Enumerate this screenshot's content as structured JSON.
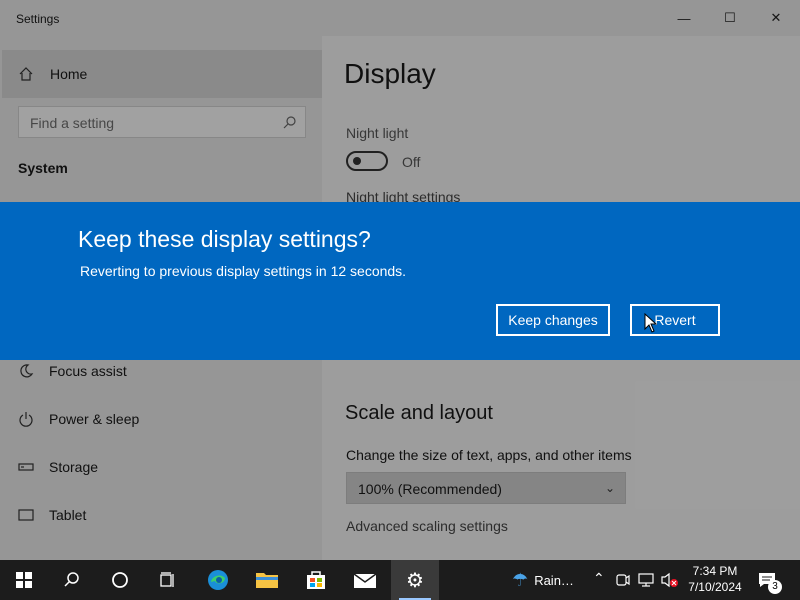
{
  "window": {
    "title": "Settings",
    "buttons": {
      "minimize": "—",
      "maximize": "☐",
      "close": "✕"
    }
  },
  "sidebar": {
    "home_label": "Home",
    "search_placeholder": "Find a setting",
    "section_heading": "System",
    "items": [
      {
        "label": "Focus assist",
        "icon": "moon-icon"
      },
      {
        "label": "Power & sleep",
        "icon": "power-icon"
      },
      {
        "label": "Storage",
        "icon": "storage-icon"
      },
      {
        "label": "Tablet",
        "icon": "tablet-icon"
      }
    ]
  },
  "content": {
    "page_title": "Display",
    "night_light_label": "Night light",
    "night_light_state": "Off",
    "night_light_settings_link": "Night light settings",
    "scale_heading": "Scale and layout",
    "scale_description": "Change the size of text, apps, and other items",
    "scale_value": "100% (Recommended)",
    "advanced_scaling_link": "Advanced scaling settings"
  },
  "dialog": {
    "title": "Keep these display settings?",
    "message": "Reverting to previous display settings in 12 seconds.",
    "keep_label": "Keep changes",
    "revert_label": "Revert",
    "background": "#0067c0"
  },
  "taskbar": {
    "weather_text": "Rain…",
    "time": "7:34 PM",
    "date": "7/10/2024",
    "notification_count": "3",
    "pinned": [
      "start-icon",
      "search-icon",
      "cortana-icon",
      "task-view-icon",
      "edge-icon",
      "file-explorer-icon",
      "store-icon",
      "mail-icon",
      "settings-icon"
    ]
  }
}
